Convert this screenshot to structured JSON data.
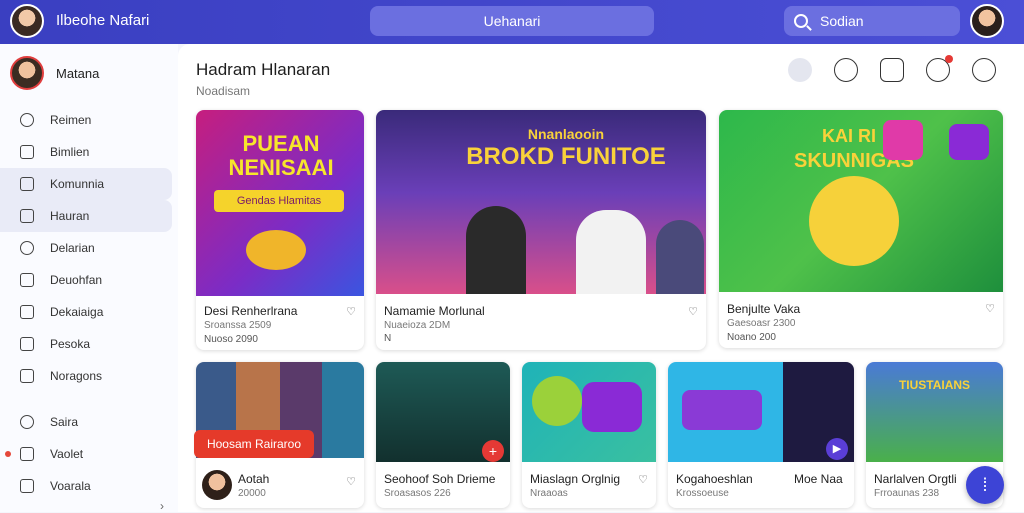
{
  "topbar": {
    "app_name": "Ilbeohe Nafari",
    "center_tab": "Uehanari",
    "search_placeholder": "Sodian"
  },
  "sidebar": {
    "user_name": "Matana",
    "items": [
      {
        "label": "Reimen",
        "icon": "user-icon"
      },
      {
        "label": "Bimlien",
        "icon": "pencil-icon"
      },
      {
        "label": "Komunnia",
        "icon": "list-icon"
      },
      {
        "label": "Hauran",
        "icon": "square-icon"
      },
      {
        "label": "Delarian",
        "icon": "chat-icon"
      },
      {
        "label": "Deuohfan",
        "icon": "document-icon"
      },
      {
        "label": "Dekaiaiga",
        "icon": "x-box-icon"
      },
      {
        "label": "Pesoka",
        "icon": "calendar-icon"
      },
      {
        "label": "Noragons",
        "icon": "map-icon"
      },
      {
        "label": "Saira",
        "icon": "circle-icon"
      },
      {
        "label": "Vaolet",
        "icon": "home-icon"
      },
      {
        "label": "Voarala",
        "icon": "image-icon"
      }
    ],
    "collapse_label": "›"
  },
  "main": {
    "title": "Hadram Hlanaran",
    "subtitle": "Noadisam"
  },
  "cards_top": [
    {
      "title": "Desi Renherlrana",
      "meta": "Sroanssa 2509",
      "meta2": "Nuoso 2090",
      "thumb_text": "PUEAN NENISAAI",
      "banner": "Gendas Hlamitas"
    },
    {
      "title": "Namamie Morlunal",
      "meta": "Nuaeioza 2DM",
      "meta2": "N",
      "thumb_text": "BROKD FUNITOE",
      "banner": "Nnanlaooin"
    },
    {
      "title": "Benjulte Vaka",
      "meta": "Gaesoasr 2300",
      "meta2": "Noano 200",
      "thumb_text": "SKUNNIGAS",
      "banner": "KAI RI"
    }
  ],
  "cards_bottom": [
    {
      "title": "Aotah",
      "meta": "20000",
      "overlay": "Hoosam Rairaroo"
    },
    {
      "title": "Seohoof Soh Drieme",
      "meta": "Sroasasos 226"
    },
    {
      "title": "Miaslagn Orglnig",
      "meta": "Nraaoas"
    },
    {
      "title": "Kogahoeshlan",
      "meta": "Krossoeuse"
    },
    {
      "title": "Moe Naa",
      "meta": ""
    },
    {
      "title": "Narlalven Orgtli",
      "meta": "Frroaunas 238",
      "thumb_text": "TIUSTAIANS"
    }
  ],
  "colors": {
    "topbar": "#3a3fc1",
    "accent": "#3d44d6",
    "red": "#e53935"
  }
}
